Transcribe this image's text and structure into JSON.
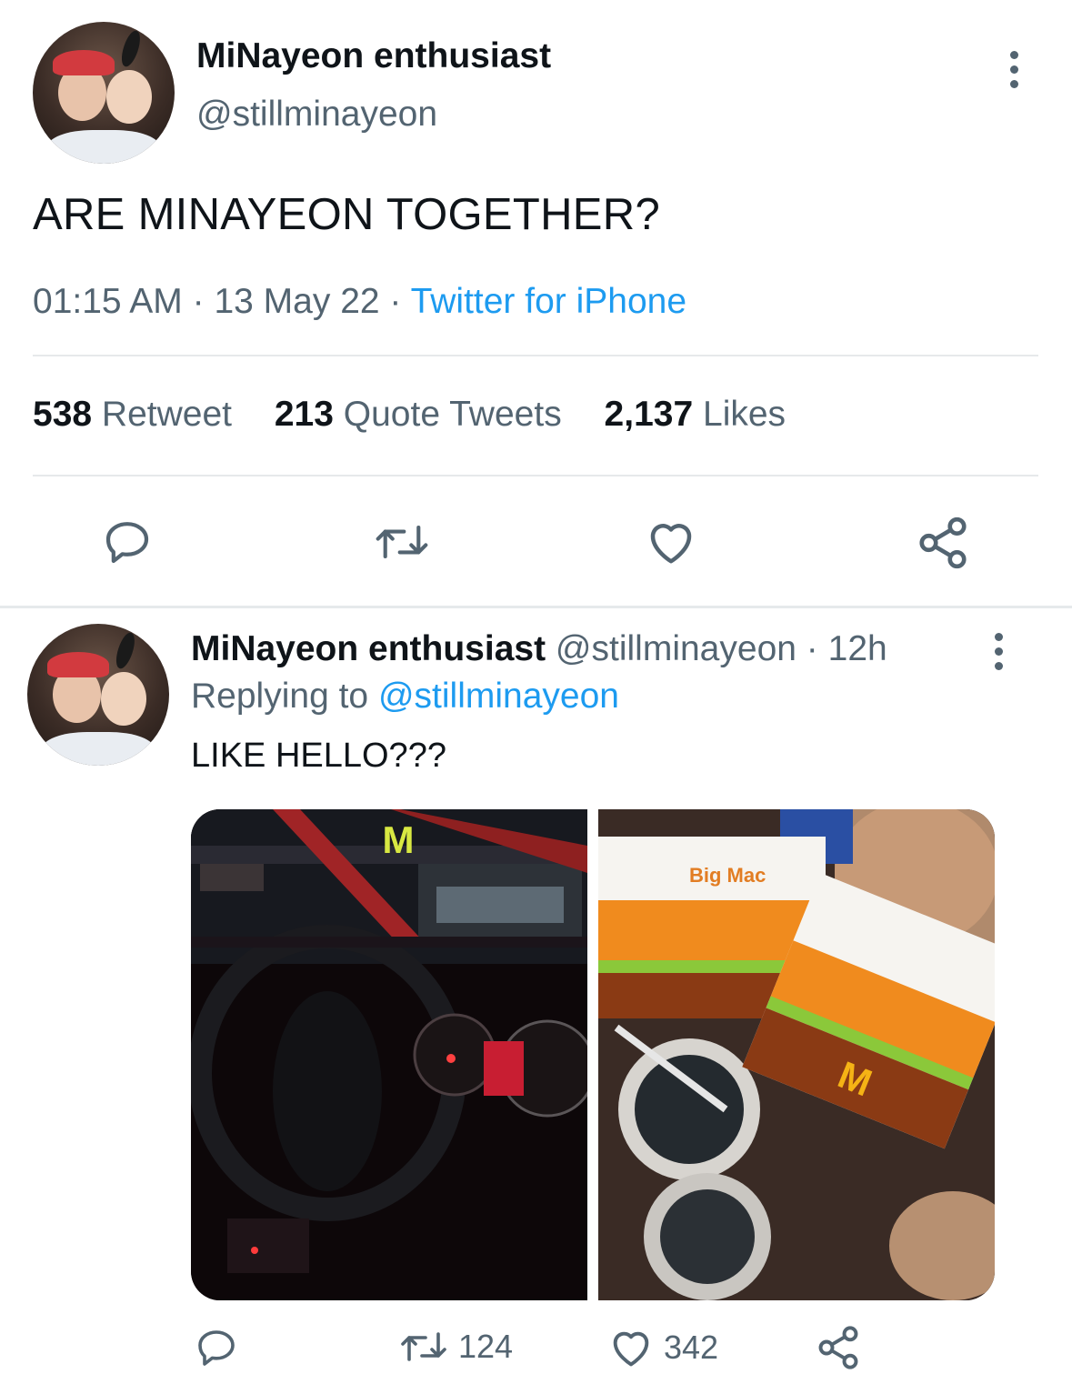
{
  "main_tweet": {
    "display_name": "MiNayeon enthusiast",
    "handle": "@stillminayeon",
    "text": "ARE MINAYEON TOGETHER?",
    "time": "01:15 AM",
    "date": "13 May 22",
    "separator": "·",
    "source": "Twitter for iPhone",
    "stats": {
      "retweets_count": "538",
      "retweets_label": "Retweet",
      "quotes_count": "213",
      "quotes_label": "Quote Tweets",
      "likes_count": "2,137",
      "likes_label": "Likes"
    },
    "actions": [
      "reply-icon",
      "retweet-icon",
      "like-icon",
      "share-icon"
    ]
  },
  "reply": {
    "display_name": "MiNayeon enthusiast",
    "handle": "@stillminayeon",
    "time": "12h",
    "separator": "·",
    "replying_label": "Replying to",
    "replying_to": "@stillminayeon",
    "text": "LIKE HELLO???",
    "photo_text": {
      "logo": "M",
      "box_label": "Big Mac"
    },
    "actions": {
      "retweet_count": "124",
      "like_count": "342"
    }
  },
  "colors": {
    "accent": "#1d9bf0",
    "secondary_text": "#536471",
    "primary_text": "#0f1419",
    "divider": "#e6e9eb"
  }
}
